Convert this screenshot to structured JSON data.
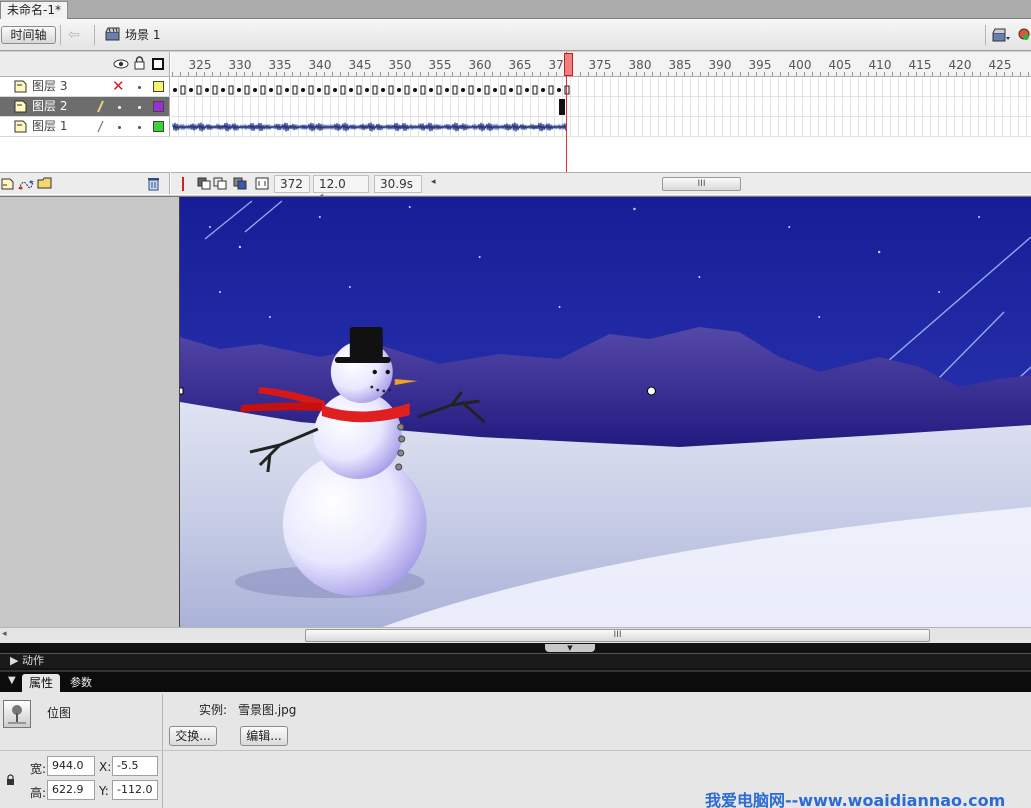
{
  "doc_tab": {
    "title": "未命名-1*"
  },
  "edit_bar": {
    "timeline_button": "时间轴",
    "scene_label": "场景 1",
    "icons": [
      "back-arrow-icon",
      "scene-icon",
      "edit-scene-icon",
      "edit-symbol-icon"
    ]
  },
  "timeline": {
    "header_icons": [
      "eye-icon",
      "lock-icon",
      "outline-icon"
    ],
    "ruler": [
      "325",
      "330",
      "335",
      "340",
      "345",
      "350",
      "355",
      "360",
      "365",
      "370",
      "375",
      "380",
      "385",
      "390",
      "395",
      "400",
      "405",
      "410",
      "415",
      "420",
      "425"
    ],
    "layers": [
      {
        "name": "图层 3",
        "color": "#f5f56a",
        "state": "hidden"
      },
      {
        "name": "图层 2",
        "color": "#9a2fd6",
        "state": "editing"
      },
      {
        "name": "图层 1",
        "color": "#36d636",
        "state": "normal"
      }
    ],
    "current_frame": "372",
    "fps": "12.0 fps",
    "elapsed": "30.9s",
    "footer_icons": [
      "insert-layer-icon",
      "add-motion-guide-icon",
      "insert-folder-icon",
      "delete-layer-icon"
    ]
  },
  "panels": {
    "actions_title": "动作",
    "tab_properties": "属性",
    "tab_parameters": "参数"
  },
  "properties": {
    "type_label": "位图",
    "instance_label": "实例:",
    "instance_value": "雪景图.jpg",
    "swap_button": "交换...",
    "edit_button": "编辑...",
    "width_label": "宽:",
    "width_value": "944.0",
    "height_label": "高:",
    "height_value": "622.9",
    "x_label": "X:",
    "x_value": "-5.5",
    "y_label": "Y:",
    "y_value": "-112.0"
  },
  "watermark": "我爱电脑网--www.woaidiannao.com"
}
